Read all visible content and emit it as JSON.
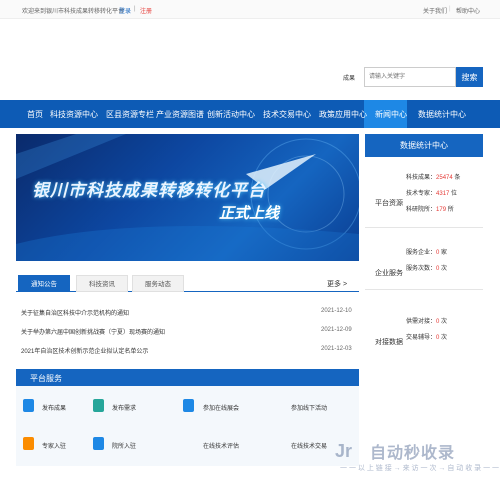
{
  "topbar": {
    "welcome": "欢迎来到银川市科技成果转移转化平台",
    "login": "登录",
    "sep": "|",
    "register": "注册",
    "about": "关于我们",
    "sep2": "|",
    "help": "帮助中心"
  },
  "search": {
    "type": "成果",
    "placeholder": "请输入关键字",
    "button": "搜索"
  },
  "nav": [
    "首页",
    "科技资源中心",
    "区县资源专栏",
    "产业资源图谱",
    "创新活动中心",
    "技术交易中心",
    "政策应用中心",
    "新闻中心",
    "数据统计中心"
  ],
  "banner": {
    "line1": "银川市科技成果转移转化平台",
    "line2": "正式上线"
  },
  "tabs": [
    "通知公告",
    "科技资讯",
    "服务动态"
  ],
  "more": "更多 >",
  "news": [
    {
      "title": "关于征集自治区科技中介示范机构的通知",
      "date": "2021-12-10"
    },
    {
      "title": "关于举办第六届中国创新挑战赛（宁夏）现场赛的通知",
      "date": "2021-12-09"
    },
    {
      "title": "2021年自治区技术创新示范企业拟认定名单公示",
      "date": "2021-12-03"
    }
  ],
  "platform_services": {
    "title": "平台服务",
    "items": [
      "发布成果",
      "发布需求",
      "参加在线展会",
      "参加线下活动",
      "专家入驻",
      "院所入驻",
      "在线技术评估",
      "在线技术交易"
    ]
  },
  "data_center": {
    "title": "数据统计中心",
    "resources": {
      "label": "平台资源",
      "items": [
        {
          "label": "科技成果：",
          "value": "25474",
          "unit": " 条"
        },
        {
          "label": "技术专家：",
          "value": "4317",
          "unit": " 位"
        },
        {
          "label": "科研院所：",
          "value": "179",
          "unit": " 所"
        }
      ]
    },
    "enterprise": {
      "label": "企业服务",
      "items": [
        {
          "label": "服务企业：",
          "value": "0",
          "unit": " 家"
        },
        {
          "label": "服务次数：",
          "value": "0",
          "unit": " 次"
        }
      ]
    },
    "matching": {
      "label": "对接数据",
      "items": [
        {
          "label": "供需对接：",
          "value": "0",
          "unit": " 次"
        },
        {
          "label": "交易辅导：",
          "value": "0",
          "unit": " 次"
        }
      ]
    }
  },
  "watermark": {
    "logo": "Jr",
    "big": "自动秒收录",
    "small": "一 一 以 上 链 接 → 来 访 一 次 → 自 动 收 录 一 一"
  }
}
